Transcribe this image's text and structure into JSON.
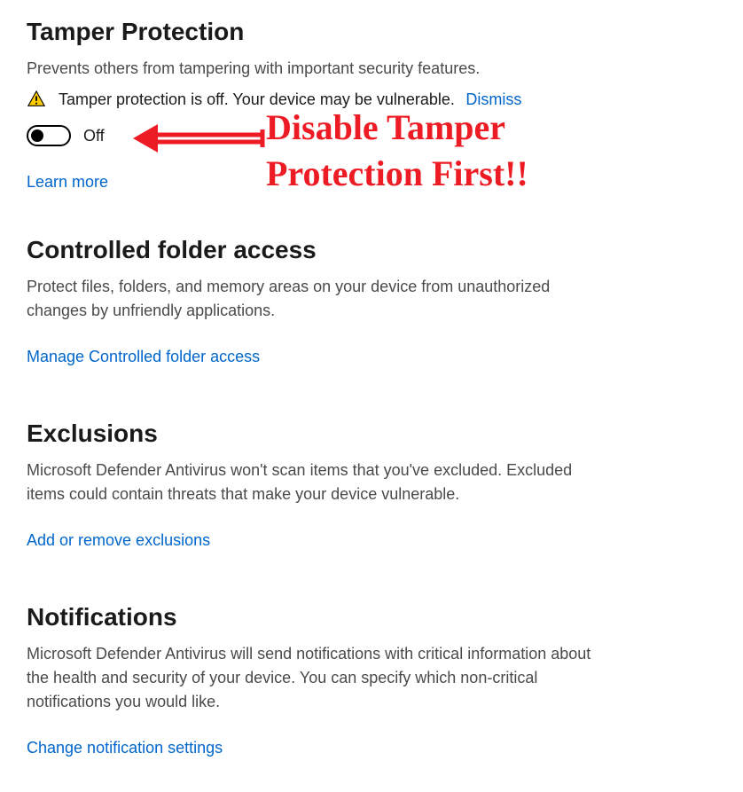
{
  "tamperProtection": {
    "title": "Tamper Protection",
    "description": "Prevents others from tampering with important security features.",
    "warningText": "Tamper protection is off. Your device may be vulnerable.",
    "dismissLabel": "Dismiss",
    "toggleState": "Off",
    "learnMoreLabel": "Learn more"
  },
  "controlledFolder": {
    "title": "Controlled folder access",
    "description": "Protect files, folders, and memory areas on your device from unauthorized changes by unfriendly applications.",
    "linkLabel": "Manage Controlled folder access"
  },
  "exclusions": {
    "title": "Exclusions",
    "description": "Microsoft Defender Antivirus won't scan items that you've excluded. Excluded items could contain threats that make your device vulnerable.",
    "linkLabel": "Add or remove exclusions"
  },
  "notifications": {
    "title": "Notifications",
    "description": "Microsoft Defender Antivirus will send notifications with critical information about the health and security of your device. You can specify which non-critical notifications you would like.",
    "linkLabel": "Change notification settings"
  },
  "annotation": {
    "line1": "Disable Tamper",
    "line2": "Protection First!!"
  },
  "colors": {
    "link": "#0066cc",
    "annotation": "#ed1c24",
    "text": "#1a1a1a",
    "muted": "#4a4a4a"
  }
}
